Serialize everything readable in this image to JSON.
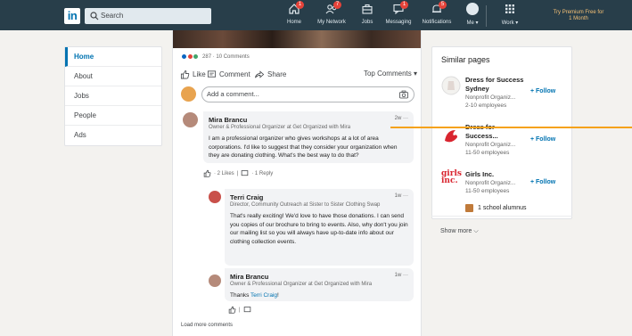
{
  "nav": {
    "logo": "in",
    "search_placeholder": "Search",
    "items": [
      {
        "label": "Home",
        "icon": "home-icon",
        "badge": "1"
      },
      {
        "label": "My Network",
        "icon": "network-icon",
        "badge": "7"
      },
      {
        "label": "Jobs",
        "icon": "jobs-icon",
        "badge": ""
      },
      {
        "label": "Messaging",
        "icon": "messaging-icon",
        "badge": "1"
      },
      {
        "label": "Notifications",
        "icon": "bell-icon",
        "badge": "5"
      },
      {
        "label": "Me ▾",
        "icon": "avatar-icon",
        "badge": ""
      },
      {
        "label": "Work ▾",
        "icon": "grid-icon",
        "badge": ""
      }
    ],
    "premium": "Try Premium Free for 1 Month"
  },
  "sidebar": {
    "items": [
      {
        "label": "Home",
        "active": true
      },
      {
        "label": "About",
        "active": false
      },
      {
        "label": "Jobs",
        "active": false
      },
      {
        "label": "People",
        "active": false
      },
      {
        "label": "Ads",
        "active": false
      }
    ]
  },
  "post": {
    "reactions_text": "287 · 10 Comments",
    "like": "Like",
    "comment": "Comment",
    "share": "Share",
    "sort": "Top Comments ▾",
    "comment_placeholder": "Add a comment...",
    "load_more": "Load more comments"
  },
  "comments": {
    "c1": {
      "name": "Mira Brancu",
      "headline": "Owner & Professional Organizer at Get Organized with Mira",
      "meta": "2w ···",
      "body": "I am a professional organizer who gives workshops at a lot of area corporations. I'd like to suggest that they consider your organization when they are donating clothing. What's the best way to do that?",
      "likes": "· 2 Likes",
      "replies": "· 1 Reply"
    },
    "c2": {
      "name": "Terri Craig",
      "headline": "Director, Community Outreach at Sister to Sister Clothing Swap",
      "meta": "1w ···",
      "body": "That's really exciting! We'd love to have those donations. I can send you copies of our brochure to bring to events. Also, why don't you join our mailing list so you will always have up-to-date info about our clothing collection events."
    },
    "c3": {
      "name": "Mira Brancu",
      "headline": "Owner & Professional Organizer at Get Organized with Mira",
      "meta": "1w ···",
      "body_prefix": "Thanks ",
      "body_link": "Terri Craig",
      "body_suffix": "!"
    }
  },
  "similar": {
    "title": "Similar pages",
    "pages": [
      {
        "name": "Dress for Success Sydney",
        "sub1": "Nonprofit Organiz...",
        "sub2": "2-10 employees",
        "follow": "+ Follow"
      },
      {
        "name": "Dress for Success...",
        "sub1": "Nonprofit Organiz...",
        "sub2": "11-50 employees",
        "follow": "+ Follow"
      },
      {
        "name": "Girls Inc.",
        "sub1": "Nonprofit Organiz...",
        "sub2": "11-50 employees",
        "follow": "+ Follow"
      }
    ],
    "alumnus": "1 school alumnus",
    "show_more": "Show more ⌵",
    "logo3_text": "girls inc."
  },
  "colors": {
    "nav_bg": "#283e4a",
    "accent": "#0073b1",
    "badge": "#e5433a",
    "premium": "#f5c075",
    "highlight_line": "#f5a21b"
  }
}
